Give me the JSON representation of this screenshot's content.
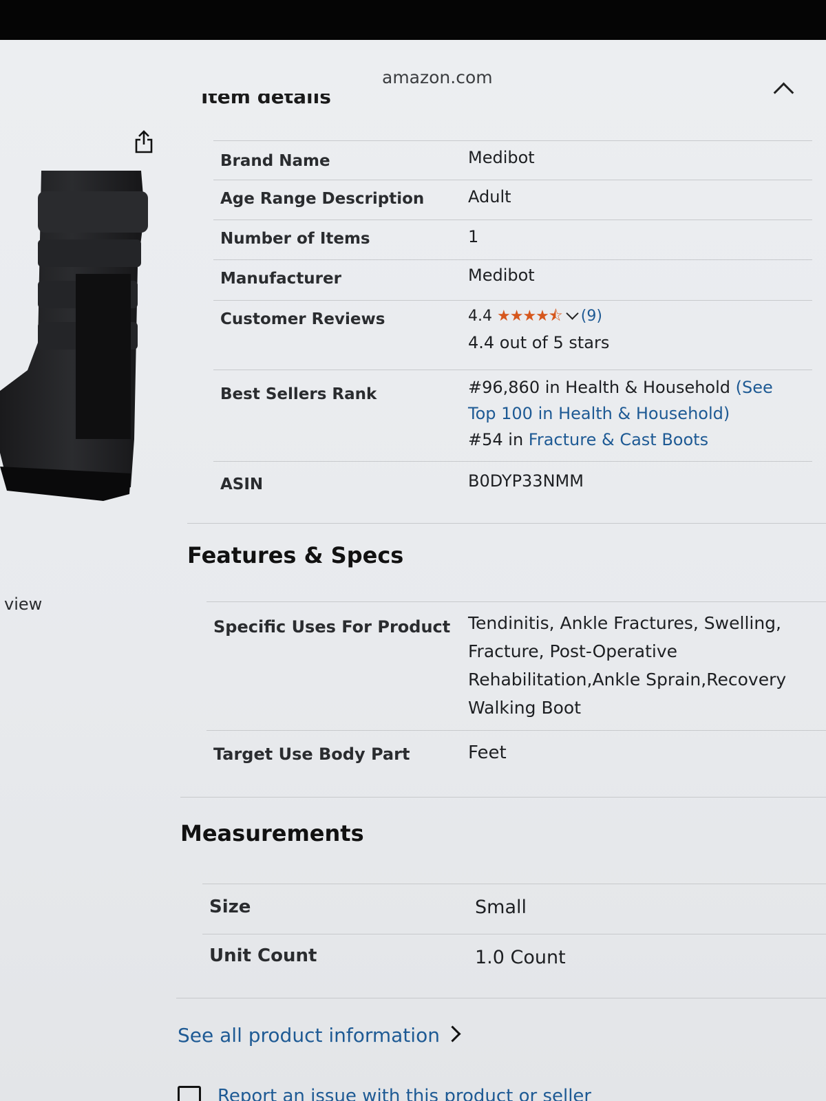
{
  "browser": {
    "url": "amazon.com"
  },
  "item_details": {
    "title": "Item details",
    "rows": [
      {
        "key": "Brand Name",
        "value": "Medibot"
      },
      {
        "key": "Age Range Description",
        "value": "Adult"
      },
      {
        "key": "Number of Items",
        "value": "1"
      },
      {
        "key": "Manufacturer",
        "value": "Medibot"
      }
    ],
    "customer_reviews": {
      "key": "Customer Reviews",
      "rating": "4.4",
      "stars": "★★★★⯪",
      "count": "(9)",
      "summary": "4.4 out of 5 stars"
    },
    "best_sellers_rank": {
      "key": "Best Sellers Rank",
      "line1_text": "#96,860 in Health & Household ",
      "line1_link": "(See",
      "line2_link": "Top 100 in Health & Household)",
      "line3_text": "#54 in ",
      "line3_link": "Fracture & Cast Boots"
    },
    "asin": {
      "key": "ASIN",
      "value": "B0DYP33NMM"
    }
  },
  "features_specs": {
    "title": "Features & Specs",
    "specific_uses": {
      "key": "Specific Uses For Product",
      "lines": [
        "Tendinitis, Ankle Fractures, Swelling,",
        "Fracture, Post-Operative",
        "Rehabilitation,Ankle Sprain,Recovery",
        "Walking Boot"
      ]
    },
    "target_body_part": {
      "key": "Target Use Body Part",
      "value": "Feet"
    }
  },
  "measurements": {
    "title": "Measurements",
    "rows": [
      {
        "key": "Size",
        "value": "Small"
      },
      {
        "key": "Unit Count",
        "value": "1.0 Count"
      }
    ]
  },
  "side": {
    "view_label": "view"
  },
  "links": {
    "see_all": "See all product information",
    "report": "Report an issue with this product or seller"
  },
  "colors": {
    "link": "#1e5a94",
    "stars": "#d6571d",
    "background": "#e9ebee"
  },
  "icons": {
    "share": "share-icon",
    "collapse": "chevron-up-icon",
    "report": "report-icon"
  }
}
